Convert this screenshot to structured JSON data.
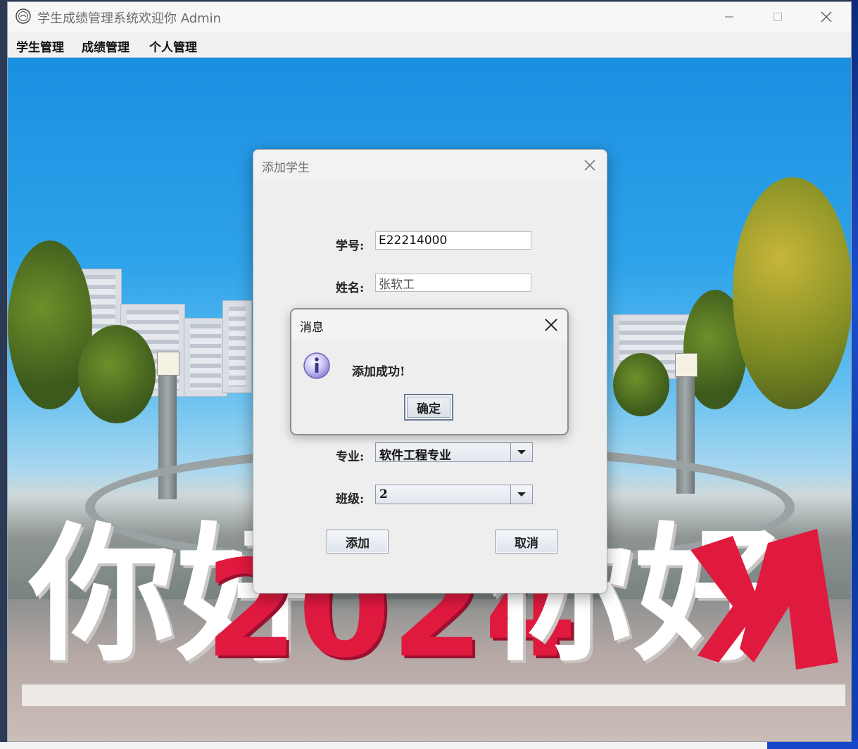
{
  "window": {
    "title": "学生成绩管理系统欢迎你  Admin"
  },
  "menubar": {
    "items": [
      {
        "label": "学生管理"
      },
      {
        "label": "成绩管理"
      },
      {
        "label": "个人管理"
      }
    ]
  },
  "background": {
    "banner_text_left": "你好",
    "banner_year": "2024",
    "banner_text_right": "你好"
  },
  "add_student_dialog": {
    "title": "添加学生",
    "student_id": {
      "label": "学号:",
      "value": "E22214000"
    },
    "name": {
      "label": "姓名:",
      "value": "张软工"
    },
    "major": {
      "label": "专业:",
      "selected": "软件工程专业"
    },
    "class": {
      "label": "班级:",
      "selected": "2"
    },
    "add_button": "添加",
    "cancel_button": "取消"
  },
  "message_dialog": {
    "title": "消息",
    "text": "添加成功!",
    "ok_button": "确定"
  },
  "colors": {
    "banner_red": "#e0193f",
    "banner_white": "#ffffff",
    "button_border": "#7f8da1"
  }
}
